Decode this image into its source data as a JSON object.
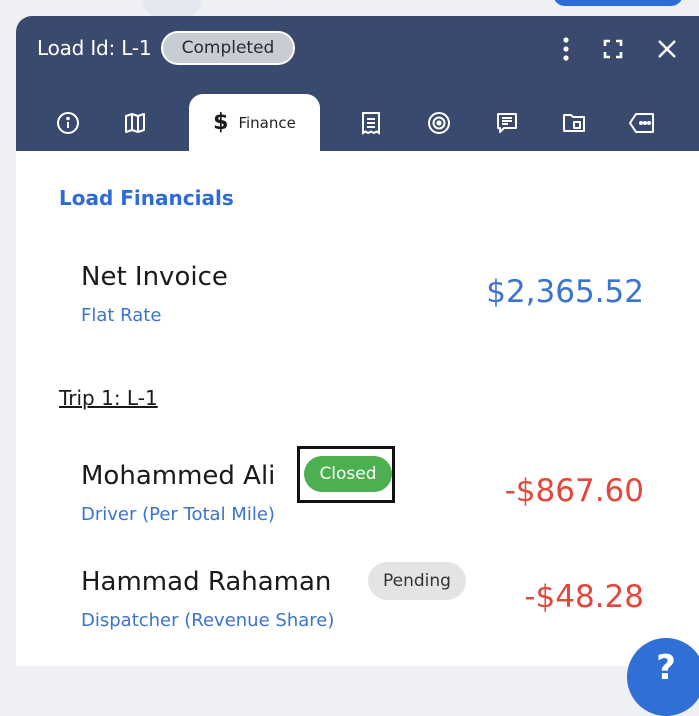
{
  "header": {
    "load_title": "Load Id: L-1",
    "status": "Completed",
    "tabs": [
      {
        "icon": "info-icon"
      },
      {
        "icon": "map-icon"
      },
      {
        "icon": "dollar-icon",
        "label": "Finance",
        "active": true
      },
      {
        "icon": "receipt-icon"
      },
      {
        "icon": "target-icon"
      },
      {
        "icon": "notes-icon"
      },
      {
        "icon": "folder-icon"
      },
      {
        "icon": "tag-icon"
      }
    ]
  },
  "finance": {
    "section_title": "Load Financials",
    "net_invoice": {
      "title": "Net Invoice",
      "subtitle": "Flat Rate",
      "amount": "$2,365.52"
    },
    "trip_title": "Trip 1: L-1",
    "payees": [
      {
        "name": "Mohammed Ali",
        "status": "Closed",
        "role": "Driver (Per Total Mile)",
        "amount": "-$867.60"
      },
      {
        "name": "Hammad Rahaman",
        "status": "Pending",
        "role": "Dispatcher (Revenue Share)",
        "amount": "-$48.28"
      }
    ]
  },
  "help": {
    "label": "?"
  },
  "colors": {
    "header_bg": "#3a4a6e",
    "accent_blue": "#3b73cf",
    "negative_red": "#e3473c",
    "closed_green": "#4caf50"
  }
}
